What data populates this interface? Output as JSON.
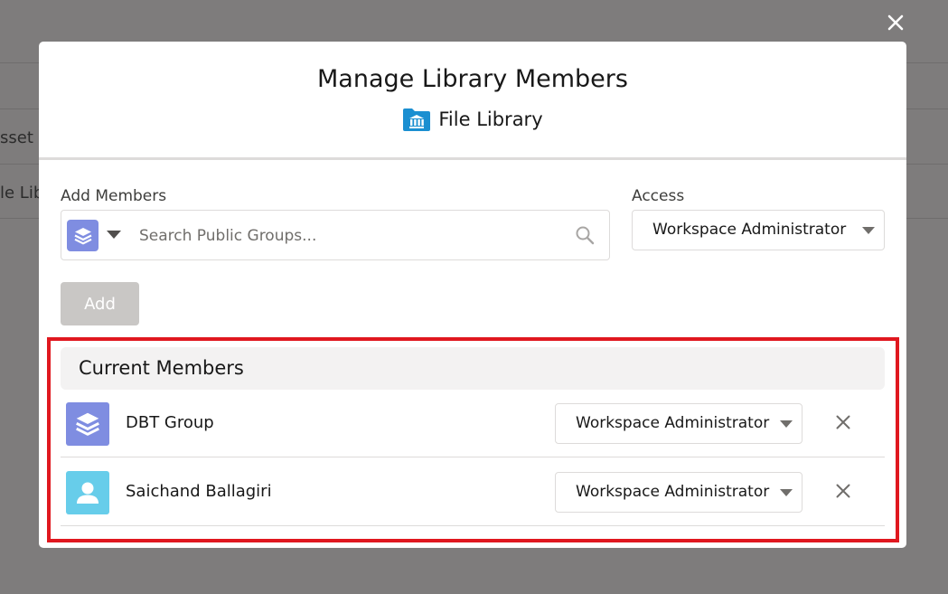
{
  "background": {
    "items": [
      {
        "label": "sset L"
      },
      {
        "label": "le Lib"
      }
    ]
  },
  "modal": {
    "title": "Manage Library Members",
    "subtitle": "File Library",
    "subtitle_icon": "library-folder-icon",
    "close_icon": "close-icon"
  },
  "add_members": {
    "label": "Add Members",
    "search_placeholder": "Search Public Groups...",
    "search_value": "",
    "type_icon": "stack-icon",
    "access_label": "Access",
    "access_value": "Workspace Administrator",
    "add_button": "Add"
  },
  "current_members": {
    "header": "Current Members",
    "members": [
      {
        "name": "DBT Group",
        "icon": "group-stack-icon",
        "icon_color": "#7f8de1",
        "access": "Workspace Administrator"
      },
      {
        "name": "Saichand Ballagiri",
        "icon": "user-avatar-icon",
        "icon_color": "#67cdea",
        "access": "Workspace Administrator"
      }
    ]
  },
  "colors": {
    "highlight": "#e0181f",
    "disabled_button": "#c9c7c5",
    "overlay": "#7e7c7c"
  }
}
